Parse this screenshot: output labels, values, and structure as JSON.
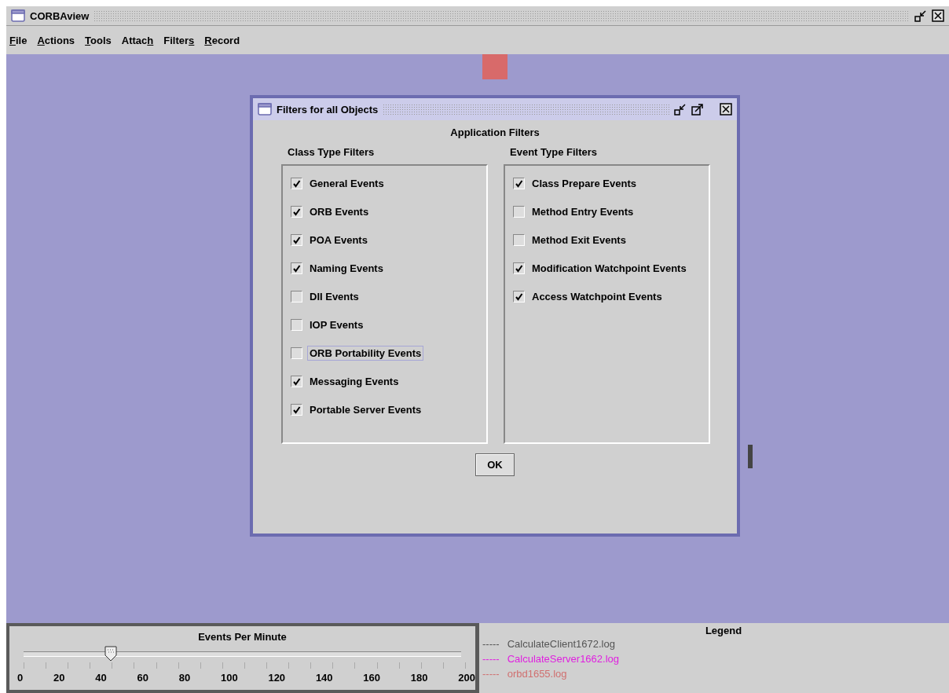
{
  "window": {
    "title": "CORBAview"
  },
  "menu": [
    {
      "segments": [
        {
          "text": "F",
          "underlined": true
        },
        {
          "text": "ile",
          "underlined": false
        }
      ]
    },
    {
      "segments": [
        {
          "text": "A",
          "underlined": true
        },
        {
          "text": "ctions",
          "underlined": false
        }
      ]
    },
    {
      "segments": [
        {
          "text": "T",
          "underlined": true
        },
        {
          "text": "ools",
          "underlined": false
        }
      ]
    },
    {
      "segments": [
        {
          "text": "Attac",
          "underlined": false
        },
        {
          "text": "h",
          "underlined": true
        }
      ]
    },
    {
      "segments": [
        {
          "text": "Filter",
          "underlined": false
        },
        {
          "text": "s",
          "underlined": true
        }
      ]
    },
    {
      "segments": [
        {
          "text": "R",
          "underlined": true
        },
        {
          "text": "ecord",
          "underlined": false
        }
      ]
    }
  ],
  "dialog": {
    "title": "Filters for all Objects",
    "heading": "Application Filters",
    "groups": [
      {
        "title": "Class Type Filters",
        "items": [
          {
            "label": "General Events",
            "checked": true,
            "focused": false
          },
          {
            "label": "ORB Events",
            "checked": true,
            "focused": false
          },
          {
            "label": "POA Events",
            "checked": true,
            "focused": false
          },
          {
            "label": "Naming Events",
            "checked": true,
            "focused": false
          },
          {
            "label": "DII Events",
            "checked": false,
            "focused": false
          },
          {
            "label": "IOP Events",
            "checked": false,
            "focused": false
          },
          {
            "label": "ORB Portability Events",
            "checked": false,
            "focused": true
          },
          {
            "label": "Messaging Events",
            "checked": true,
            "focused": false
          },
          {
            "label": "Portable Server Events",
            "checked": true,
            "focused": false
          }
        ]
      },
      {
        "title": "Event Type Filters",
        "items": [
          {
            "label": "Class Prepare Events",
            "checked": true,
            "focused": false
          },
          {
            "label": "Method Entry Events",
            "checked": false,
            "focused": false
          },
          {
            "label": "Method Exit Events",
            "checked": false,
            "focused": false
          },
          {
            "label": "Modification Watchpoint Events",
            "checked": true,
            "focused": false
          },
          {
            "label": "Access Watchpoint Events",
            "checked": true,
            "focused": false
          }
        ]
      }
    ],
    "ok_button": "OK"
  },
  "rate_panel": {
    "title": "Events Per Minute",
    "level": 0.2,
    "tick_labels": [
      "0",
      "20",
      "40",
      "60",
      "80",
      "100",
      "120",
      "140",
      "160",
      "180",
      "200"
    ]
  },
  "legend": {
    "title": "Legend",
    "entries": [
      {
        "dashes": "-----",
        "name": "CalculateClient1672.log",
        "color": "#555555"
      },
      {
        "dashes": "-----",
        "name": "CalculateServer1662.log",
        "color": "#e020e0"
      },
      {
        "dashes": "-----",
        "name": "orbd1655.log",
        "color": "#d07070"
      }
    ]
  }
}
